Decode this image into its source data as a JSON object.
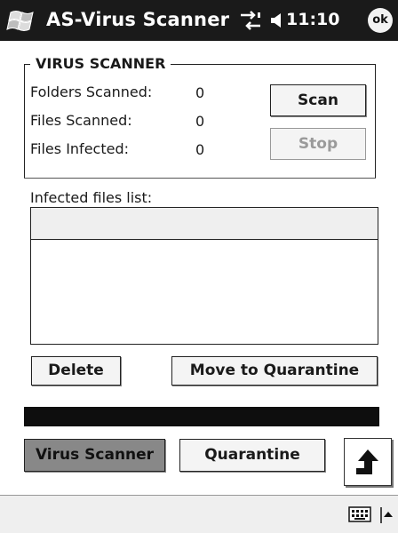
{
  "titlebar": {
    "title": "AS-Virus Scanner",
    "time": "11:10",
    "ok_label": "ok"
  },
  "scanner": {
    "group_label": "VIRUS SCANNER",
    "folders_label": "Folders Scanned:",
    "folders_value": "0",
    "files_label": "Files Scanned:",
    "files_value": "0",
    "infected_label": "Files Infected:",
    "infected_value": "0",
    "scan_label": "Scan",
    "stop_label": "Stop"
  },
  "list": {
    "label": "Infected files list:",
    "items": []
  },
  "actions": {
    "delete_label": "Delete",
    "quarantine_label": "Move to Quarantine"
  },
  "tabs": [
    {
      "label": "Virus Scanner",
      "active": true
    },
    {
      "label": "Quarantine",
      "active": false
    }
  ],
  "icons": {
    "start": "windows-flag-icon",
    "connection": "connectivity-arrows-icon",
    "volume": "speaker-icon",
    "up": "up-arrow-icon",
    "keyboard": "keyboard-icon",
    "sip": "sip-menu-arrow-icon"
  },
  "colors": {
    "titlebar": "#1a1a1a",
    "active_tab": "#888888",
    "band": "#0e0e0e",
    "disabled_text": "#9a9a9a"
  }
}
